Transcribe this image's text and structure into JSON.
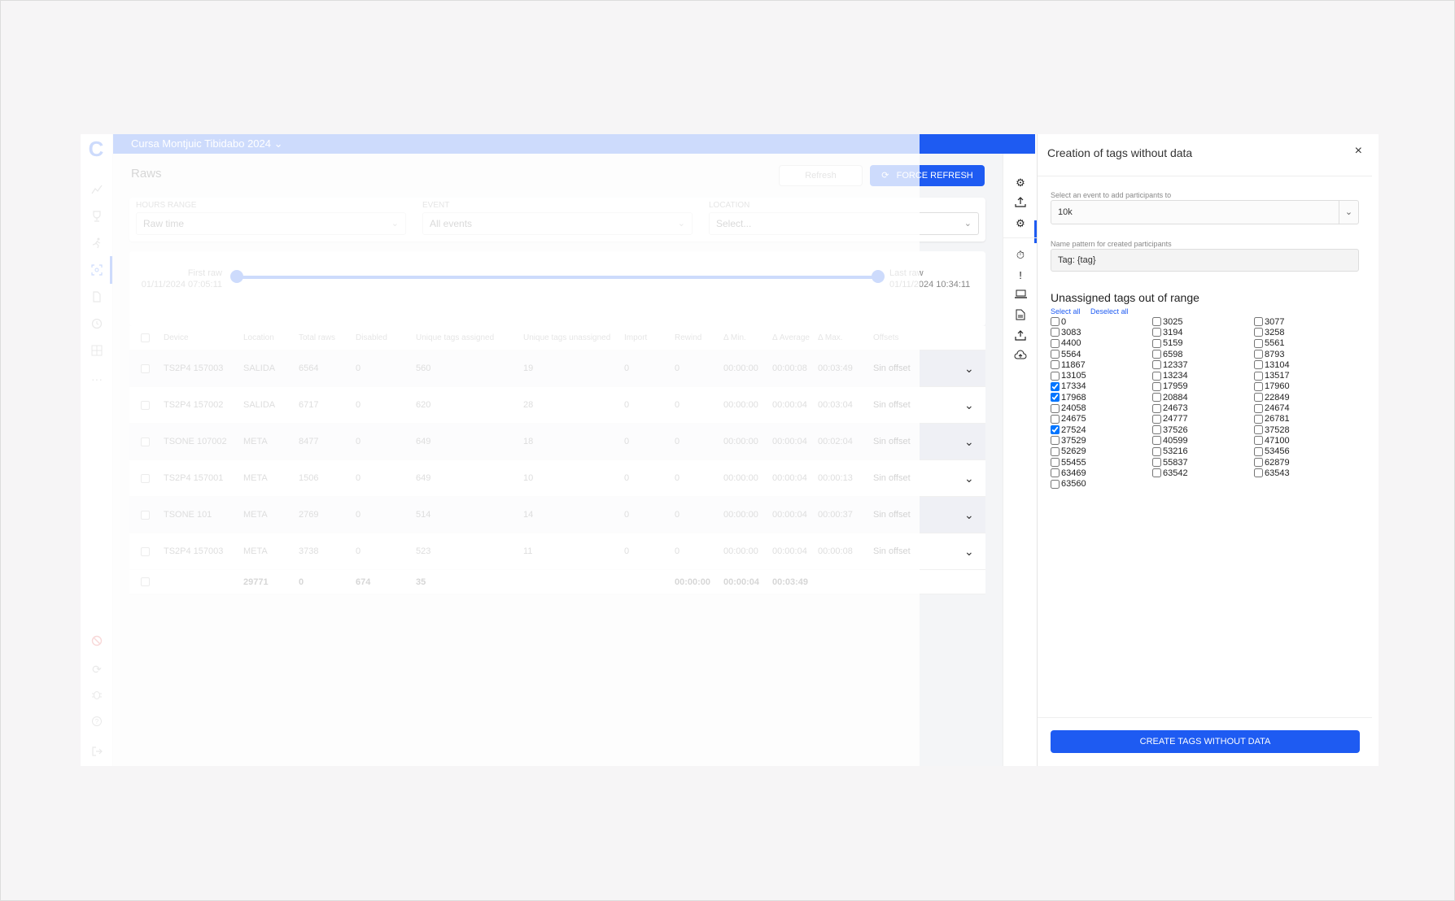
{
  "app": {
    "event_name": "Cursa Montjuic Tibidabo 2024",
    "page_title": "Raws",
    "secondary_button": "Refresh",
    "force_refresh_label": "FORCE REFRESH"
  },
  "filters": {
    "hours_range": {
      "label": "HOURS RANGE",
      "value": "Raw time"
    },
    "event": {
      "label": "EVENT",
      "value": "All events"
    },
    "location": {
      "label": "LOCATION",
      "placeholder": "Select..."
    }
  },
  "slider": {
    "first_label": "First raw",
    "first_value": "01/11/2024 07:05:11",
    "last_label": "Last raw",
    "last_value": "01/11/2024 10:34:11"
  },
  "table": {
    "headers": [
      "Device",
      "Location",
      "Total raws",
      "Disabled",
      "Unique tags assigned",
      "Unique tags unassigned",
      "Import",
      "Rewind",
      "Δ Min.",
      "Δ Average",
      "Δ Max.",
      "Offsets"
    ],
    "rows": [
      {
        "device": "TS2P4 157003",
        "location": "SALIDA",
        "total": "6564",
        "disabled": "0",
        "assigned": "560",
        "unassigned": "19",
        "import": "0",
        "rewind": "0",
        "min": "00:00:00",
        "avg": "00:00:08",
        "max": "00:03:49",
        "offset": "Sin offset"
      },
      {
        "device": "TS2P4 157002",
        "location": "SALIDA",
        "total": "6717",
        "disabled": "0",
        "assigned": "620",
        "unassigned": "28",
        "import": "0",
        "rewind": "0",
        "min": "00:00:00",
        "avg": "00:00:04",
        "max": "00:03:04",
        "offset": "Sin offset"
      },
      {
        "device": "TSONE 107002",
        "location": "META",
        "total": "8477",
        "disabled": "0",
        "assigned": "649",
        "unassigned": "18",
        "import": "0",
        "rewind": "0",
        "min": "00:00:00",
        "avg": "00:00:04",
        "max": "00:02:04",
        "offset": "Sin offset"
      },
      {
        "device": "TS2P4 157001",
        "location": "META",
        "total": "1506",
        "disabled": "0",
        "assigned": "649",
        "unassigned": "10",
        "import": "0",
        "rewind": "0",
        "min": "00:00:00",
        "avg": "00:00:04",
        "max": "00:00:13",
        "offset": "Sin offset"
      },
      {
        "device": "TSONE 101",
        "location": "META",
        "total": "2769",
        "disabled": "0",
        "assigned": "514",
        "unassigned": "14",
        "import": "0",
        "rewind": "0",
        "min": "00:00:00",
        "avg": "00:00:04",
        "max": "00:00:37",
        "offset": "Sin offset"
      },
      {
        "device": "TS2P4 157003",
        "location": "META",
        "total": "3738",
        "disabled": "0",
        "assigned": "523",
        "unassigned": "11",
        "import": "0",
        "rewind": "0",
        "min": "00:00:00",
        "avg": "00:00:04",
        "max": "00:00:08",
        "offset": "Sin offset"
      }
    ],
    "totals": {
      "total": "29771",
      "disabled": "0",
      "assigned": "674",
      "unassigned": "35",
      "min": "00:00:00",
      "avg": "00:00:04",
      "max": "00:03:49"
    }
  },
  "panel": {
    "title": "Creation of tags without data",
    "close": "×",
    "event_label": "Select an event to add participants to",
    "event_value": "10k",
    "pattern_label": "Name pattern for created participants",
    "pattern_value": "Tag: {tag}",
    "section_title": "Unassigned tags out of range",
    "select_all": "Select all",
    "deselect_all": "Deselect all",
    "tags": [
      {
        "id": "0",
        "checked": false
      },
      {
        "id": "3025",
        "checked": false
      },
      {
        "id": "3077",
        "checked": false
      },
      {
        "id": "3083",
        "checked": false
      },
      {
        "id": "3194",
        "checked": false
      },
      {
        "id": "3258",
        "checked": false
      },
      {
        "id": "4400",
        "checked": false
      },
      {
        "id": "5159",
        "checked": false
      },
      {
        "id": "5561",
        "checked": false
      },
      {
        "id": "5564",
        "checked": false
      },
      {
        "id": "6598",
        "checked": false
      },
      {
        "id": "8793",
        "checked": false
      },
      {
        "id": "11867",
        "checked": false
      },
      {
        "id": "12337",
        "checked": false
      },
      {
        "id": "13104",
        "checked": false
      },
      {
        "id": "13105",
        "checked": false
      },
      {
        "id": "13234",
        "checked": false
      },
      {
        "id": "13517",
        "checked": false
      },
      {
        "id": "17334",
        "checked": true
      },
      {
        "id": "17959",
        "checked": false
      },
      {
        "id": "17960",
        "checked": false
      },
      {
        "id": "17968",
        "checked": true
      },
      {
        "id": "20884",
        "checked": false
      },
      {
        "id": "22849",
        "checked": false
      },
      {
        "id": "24058",
        "checked": false
      },
      {
        "id": "24673",
        "checked": false
      },
      {
        "id": "24674",
        "checked": false
      },
      {
        "id": "24675",
        "checked": false
      },
      {
        "id": "24777",
        "checked": false
      },
      {
        "id": "26781",
        "checked": false
      },
      {
        "id": "27524",
        "checked": true
      },
      {
        "id": "37526",
        "checked": false
      },
      {
        "id": "37528",
        "checked": false
      },
      {
        "id": "37529",
        "checked": false
      },
      {
        "id": "40599",
        "checked": false
      },
      {
        "id": "47100",
        "checked": false
      },
      {
        "id": "52629",
        "checked": false
      },
      {
        "id": "53216",
        "checked": false
      },
      {
        "id": "53456",
        "checked": false
      },
      {
        "id": "55455",
        "checked": false
      },
      {
        "id": "55837",
        "checked": false
      },
      {
        "id": "62879",
        "checked": false
      },
      {
        "id": "63469",
        "checked": false
      },
      {
        "id": "63542",
        "checked": false
      },
      {
        "id": "63543",
        "checked": false
      },
      {
        "id": "63560",
        "checked": false
      }
    ],
    "create_button": "CREATE TAGS WITHOUT DATA"
  },
  "icons": {
    "rail": [
      "logo-icon",
      "chart-icon",
      "trophy-icon",
      "runner-icon",
      "scan-icon",
      "document-icon",
      "clock-icon",
      "grid-icon",
      "more-icon",
      "ban-icon",
      "sync-icon",
      "bug-icon",
      "help-icon",
      "logout-icon"
    ],
    "toolbar": [
      "gears-icon",
      "upload-icon",
      "settings-icon",
      "stopwatch-icon",
      "alert-icon",
      "laptop-icon",
      "file-icon",
      "upload-tray-icon",
      "cloud-upload-icon"
    ]
  },
  "colors": {
    "accent": "#1e5bf2"
  }
}
